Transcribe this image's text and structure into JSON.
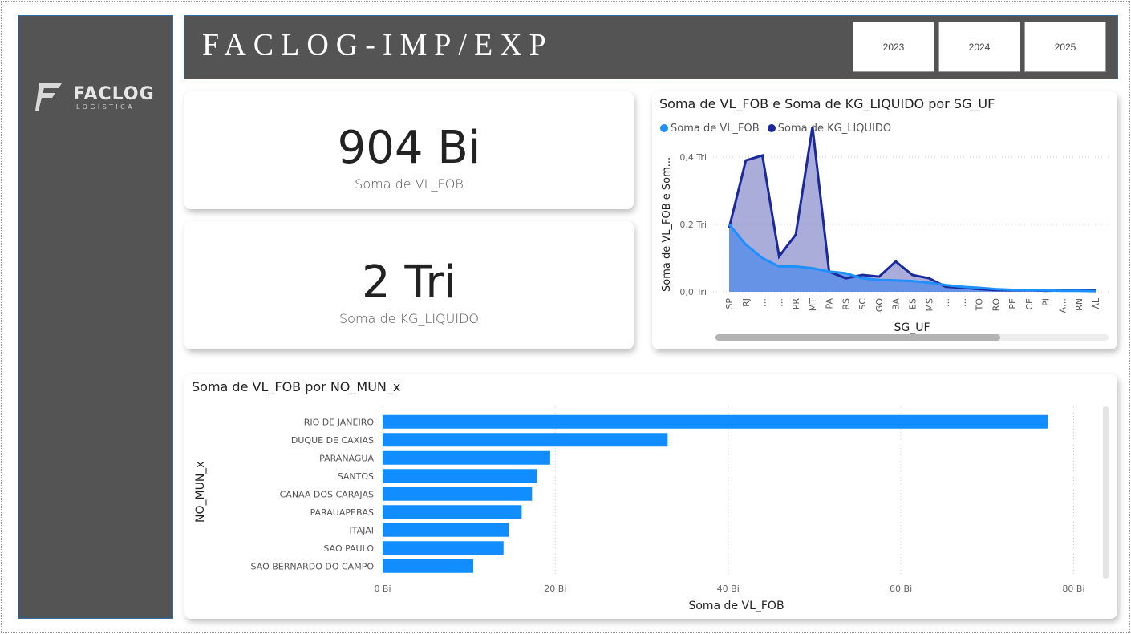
{
  "header": {
    "title": "FACLOG-IMP/EXP",
    "year_buttons": [
      "2023",
      "2024",
      "2025"
    ]
  },
  "logo": {
    "name": "FACLOG",
    "tagline": "LOGÍSTICA"
  },
  "kpis": [
    {
      "value": "904 Bi",
      "label": "Soma de VL_FOB"
    },
    {
      "value": "2 Tri",
      "label": "Soma de KG_LIQUIDO"
    }
  ],
  "colors": {
    "panel": "#545454",
    "series_fob": "#1e90ff",
    "series_kg": "#1a2a9c",
    "bar": "#118dff"
  },
  "area_chart": {
    "title": "Soma de VL_FOB e Soma de KG_LIQUIDO por SG_UF",
    "legend": [
      "Soma de VL_FOB",
      "Soma de KG_LIQUIDO"
    ],
    "xlabel": "SG_UF",
    "ylabel": "Soma de VL_FOB e Som...",
    "ytick_labels": [
      "0,0 Tri",
      "0,2 Tri",
      "0,4 Tri"
    ]
  },
  "bar_chart": {
    "title": "Soma de VL_FOB por NO_MUN_x",
    "xlabel": "Soma de VL_FOB",
    "ylabel": "NO_MUN_x",
    "xtick_labels": [
      "0 Bi",
      "20 Bi",
      "40 Bi",
      "60 Bi",
      "80 Bi"
    ]
  },
  "chart_data": [
    {
      "type": "area",
      "title": "Soma de VL_FOB e Soma de KG_LIQUIDO por SG_UF",
      "xlabel": "SG_UF",
      "ylabel": "Soma de VL_FOB e Som...",
      "categories": [
        "SP",
        "RJ",
        "…",
        "…",
        "PR",
        "MT",
        "PA",
        "RS",
        "SC",
        "GO",
        "BA",
        "ES",
        "MS",
        "…",
        "…",
        "TO",
        "RO",
        "PE",
        "CE",
        "PI",
        "A…",
        "RN",
        "AL"
      ],
      "series": [
        {
          "name": "Soma de VL_FOB",
          "values": [
            0.2,
            0.14,
            0.1,
            0.075,
            0.075,
            0.07,
            0.06,
            0.055,
            0.04,
            0.035,
            0.034,
            0.032,
            0.027,
            0.02,
            0.015,
            0.012,
            0.008,
            0.006,
            0.005,
            0.004,
            0.003,
            0.003,
            0.002
          ]
        },
        {
          "name": "Soma de KG_LIQUIDO",
          "values": [
            0.19,
            0.39,
            0.405,
            0.105,
            0.17,
            0.49,
            0.06,
            0.04,
            0.05,
            0.045,
            0.09,
            0.05,
            0.04,
            0.015,
            0.012,
            0.008,
            0.005,
            0.005,
            0.005,
            0.003,
            0.004,
            0.006,
            0.004
          ]
        }
      ],
      "ylim": [
        0,
        0.5
      ],
      "ytick_values": [
        0,
        0.2,
        0.4
      ],
      "grid": true,
      "legend_position": "top-left"
    },
    {
      "type": "bar",
      "orientation": "horizontal",
      "title": "Soma de VL_FOB por NO_MUN_x",
      "xlabel": "Soma de VL_FOB",
      "ylabel": "NO_MUN_x",
      "categories": [
        "RIO DE JANEIRO",
        "DUQUE DE CAXIAS",
        "PARANAGUA",
        "SANTOS",
        "CANAA DOS CARAJAS",
        "PARAUAPEBAS",
        "ITAJAI",
        "SAO PAULO",
        "SAO BERNARDO DO CAMPO"
      ],
      "values": [
        77,
        33,
        19.4,
        17.9,
        17.3,
        16.1,
        14.6,
        14.0,
        10.5
      ],
      "xlim": [
        0,
        82
      ],
      "xtick_values": [
        0,
        20,
        40,
        60,
        80
      ],
      "grid": true
    }
  ]
}
